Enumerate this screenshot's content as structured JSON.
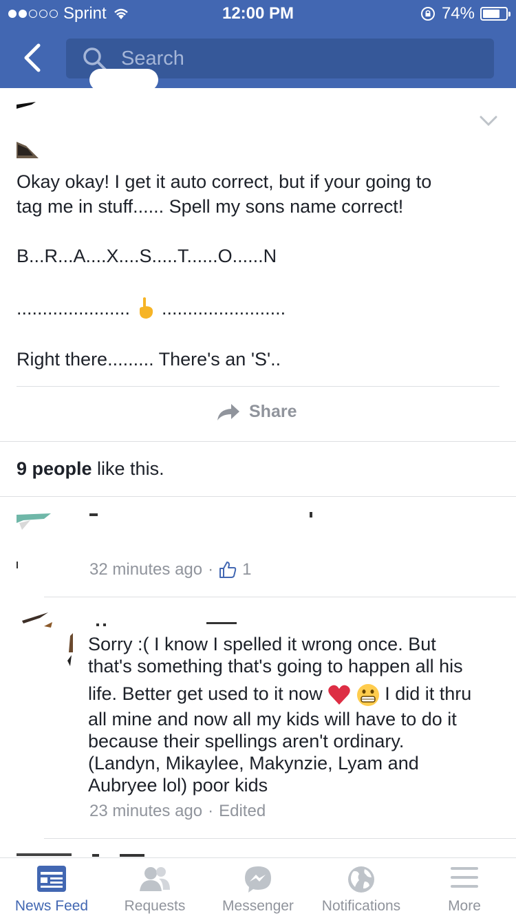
{
  "status_bar": {
    "carrier": "Sprint",
    "time": "12:00 PM",
    "battery": "74%",
    "battery_level": 0.74
  },
  "header": {
    "search_placeholder": "Search"
  },
  "post": {
    "line1": "Okay okay! I get it auto correct, but if your going to",
    "line2": "tag me in stuff...... Spell my sons name correct!",
    "line3": "B...R...A....X....S.....T......O......N",
    "dots_left": "......................",
    "dots_right": "........................",
    "line5": "Right there......... There's an 'S'..",
    "share_label": "Share"
  },
  "likes": {
    "count": "9 people",
    "suffix": " like this."
  },
  "comments": [
    {
      "time": "32 minutes ago",
      "separator": "·",
      "like_count": "1"
    },
    {
      "line1": "Sorry :( I know I spelled it wrong once. But",
      "line2": "that's something that's going to happen all his",
      "line3a": "life. Better get used to it now",
      "line3b": "I did it thru",
      "line4": "all mine and now all my kids will have to do it",
      "line5": "because their spellings aren't ordinary.",
      "line6": "(Landyn, Mikaylee, Makynzie, Lyam and",
      "line7": "Aubryee lol) poor kids",
      "time": "23 minutes ago",
      "separator": "·",
      "edited": "Edited"
    }
  ],
  "tabbar": {
    "items": [
      {
        "label": "News Feed",
        "icon": "news-feed-icon"
      },
      {
        "label": "Requests",
        "icon": "requests-icon"
      },
      {
        "label": "Messenger",
        "icon": "messenger-icon"
      },
      {
        "label": "Notifications",
        "icon": "globe-icon"
      },
      {
        "label": "More",
        "icon": "menu-icon"
      }
    ]
  },
  "colors": {
    "brand": "#4267b2",
    "search_bg": "#365899",
    "muted": "#90949c"
  }
}
